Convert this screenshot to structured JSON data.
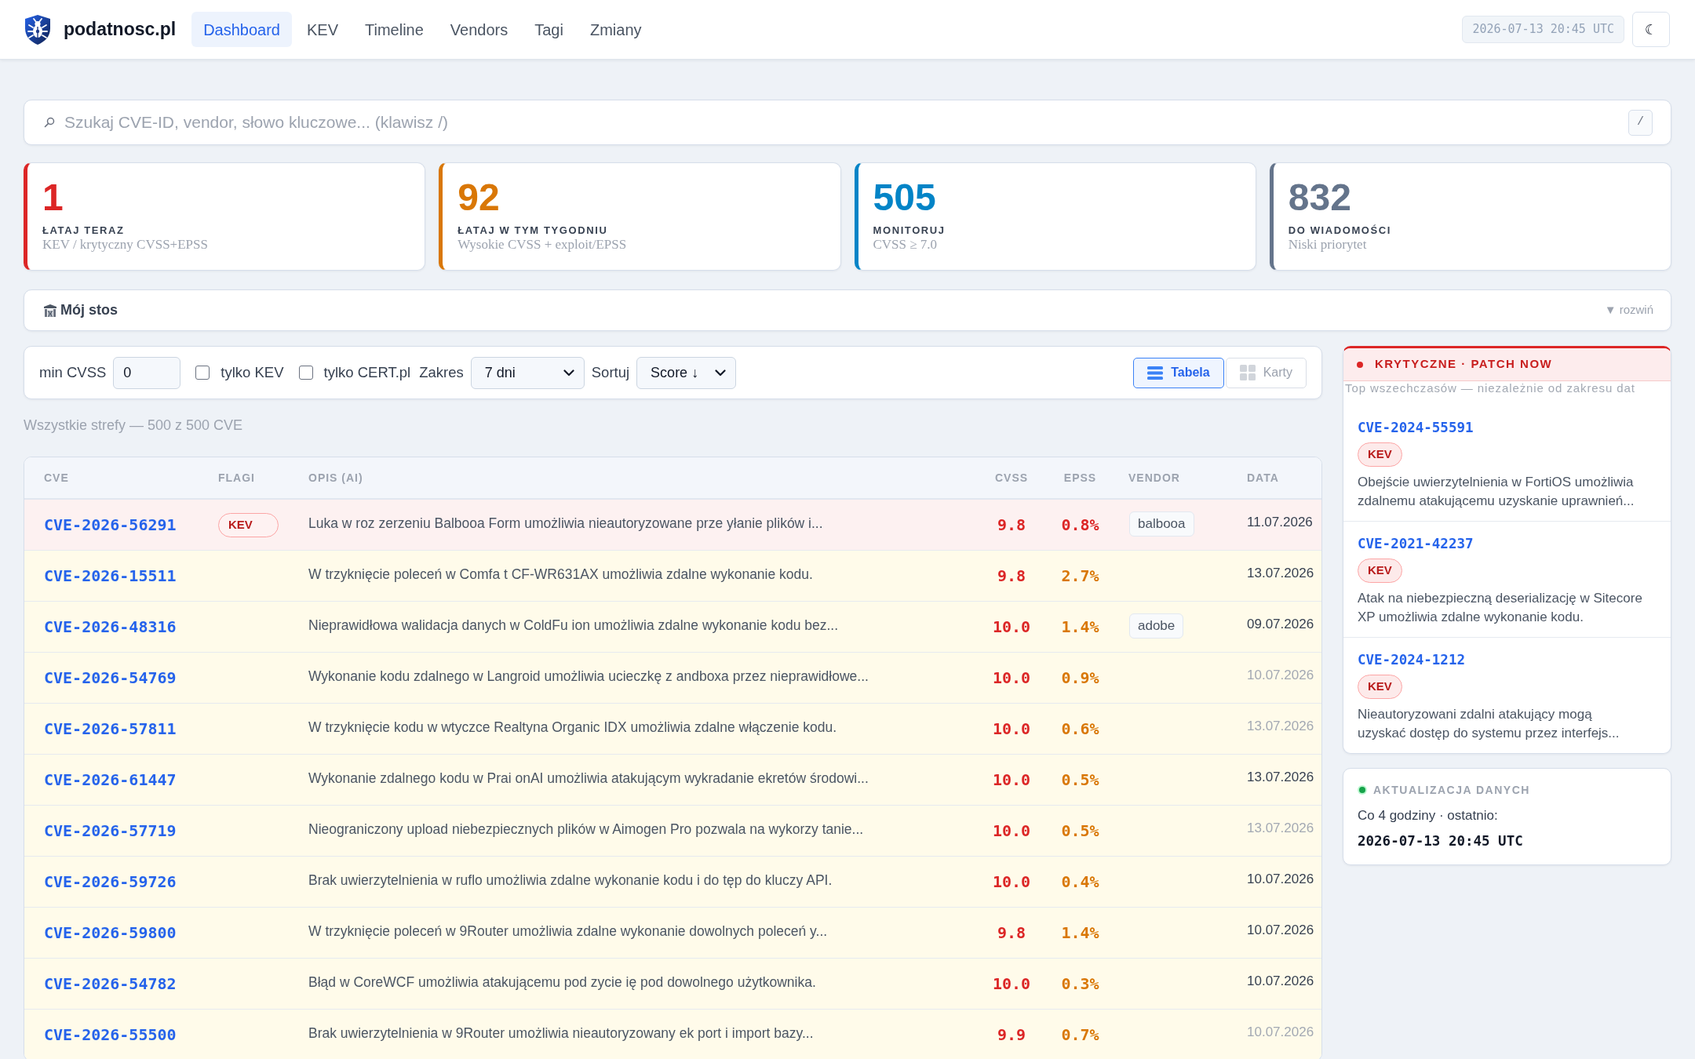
{
  "header": {
    "brand": "podatnosc.pl",
    "nav": [
      {
        "label": "Dashboard",
        "selected": true
      },
      {
        "label": "KEV",
        "selected": false
      },
      {
        "label": "Timeline",
        "selected": false
      },
      {
        "label": "Vendors",
        "selected": false
      },
      {
        "label": "Tagi",
        "selected": false
      },
      {
        "label": "Zmiany",
        "selected": false
      }
    ],
    "timestamp": "2026-07-13 20:45 UTC",
    "theme_toggle": "☾"
  },
  "search": {
    "placeholder": "Szukaj CVE-ID, vendor, słowo kluczowe... (klawisz /)",
    "shortcut": "/"
  },
  "stats": [
    {
      "value": "1",
      "label": "ŁATAJ TERAZ",
      "note": "KEV / krytyczny CVSS+EPSS",
      "color": "#dc2626"
    },
    {
      "value": "92",
      "label": "ŁATAJ W TYM TYGODNIU",
      "note": "Wysokie CVSS + exploit/EPSS",
      "color": "#d97706"
    },
    {
      "value": "505",
      "label": "MONITORUJ",
      "note": "CVSS ≥ 7.0",
      "color": "#0284c7"
    },
    {
      "value": "832",
      "label": "DO WIADOMOŚCI",
      "note": "Niski priorytet",
      "color": "#64748b"
    }
  ],
  "stack": {
    "title": "Mój stos",
    "toggle": "▼ rozwiń"
  },
  "filters": {
    "min_cvss": {
      "label": "min CVSS",
      "value": "0"
    },
    "checkboxes": [
      {
        "label": "tylko KEV",
        "checked": false
      },
      {
        "label": "tylko CERT.pl",
        "checked": false
      }
    ],
    "range": {
      "label": "Zakres",
      "value": "7 dni"
    },
    "sort": {
      "label": "Sortuj",
      "value": "Score ↓"
    },
    "views": [
      {
        "label": "Tabela",
        "kind": "table",
        "selected": true
      },
      {
        "label": "Karty",
        "kind": "cards",
        "selected": false
      }
    ]
  },
  "summary": "Wszystkie strefy — 500 z 500 CVE",
  "table": {
    "columns": [
      "CVE",
      "FLAGI",
      "OPIS (AI)",
      "CVSS",
      "EPSS",
      "VENDOR",
      "DATA"
    ],
    "rows": [
      {
        "kind": "critical",
        "cve": "CVE-2026-56291",
        "flags": [
          "KEV"
        ],
        "description": "Luka w roz zerzeniu Balbooa Form umożliwia nieautoryzowane prze yłanie plików i...",
        "cvss": "9.8",
        "epss": "0.8%",
        "vendor": "balbooa",
        "date": "11.07.2026",
        "date_dimmed": false
      },
      {
        "kind": "high",
        "cve": "CVE-2026-15511",
        "description": "W trzyknięcie poleceń w Comfa t CF-WR631AX umożliwia zdalne wykonanie kodu.",
        "cvss": "9.8",
        "epss": "2.7%",
        "date": "13.07.2026",
        "date_dimmed": false
      },
      {
        "kind": "high",
        "cve": "CVE-2026-48316",
        "description": "Nieprawidłowa walidacja danych w ColdFu ion umożliwia zdalne wykonanie kodu bez...",
        "cvss": "10.0",
        "epss": "1.4%",
        "vendor": "adobe",
        "date": "09.07.2026",
        "date_dimmed": false
      },
      {
        "kind": "high",
        "cve": "CVE-2026-54769",
        "description": "Wykonanie kodu zdalnego w Langroid umożliwia ucieczkę z andboxa przez nieprawidłowe...",
        "cvss": "10.0",
        "epss": "0.9%",
        "date": "10.07.2026",
        "date_dimmed": true
      },
      {
        "kind": "high",
        "cve": "CVE-2026-57811",
        "description": "W trzyknięcie kodu w wtyczce Realtyna Organic IDX umożliwia zdalne włączenie kodu.",
        "cvss": "10.0",
        "epss": "0.6%",
        "date": "13.07.2026",
        "date_dimmed": true
      },
      {
        "kind": "high",
        "cve": "CVE-2026-61447",
        "description": "Wykonanie zdalnego kodu w Prai onAI umożliwia atakującym wykradanie ekretów środowi...",
        "cvss": "10.0",
        "epss": "0.5%",
        "date": "13.07.2026",
        "date_dimmed": false
      },
      {
        "kind": "high",
        "cve": "CVE-2026-57719",
        "description": "Nieograniczony upload niebezpiecznych plików w Aimogen Pro pozwala na wykorzy tanie...",
        "cvss": "10.0",
        "epss": "0.5%",
        "date": "13.07.2026",
        "date_dimmed": true
      },
      {
        "kind": "high",
        "cve": "CVE-2026-59726",
        "description": "Brak uwierzytelnienia w ruflo umożliwia zdalne wykonanie kodu i do tęp do kluczy API.",
        "cvss": "10.0",
        "epss": "0.4%",
        "date": "10.07.2026",
        "date_dimmed": false
      },
      {
        "kind": "high",
        "cve": "CVE-2026-59800",
        "description": "W trzyknięcie poleceń w 9Router umożliwia zdalne wykonanie dowolnych poleceń y...",
        "cvss": "9.8",
        "epss": "1.4%",
        "date": "10.07.2026",
        "date_dimmed": false
      },
      {
        "kind": "high",
        "cve": "CVE-2026-54782",
        "description": "Błąd w CoreWCF umożliwia atakującemu pod zycie ię pod dowolnego użytkownika.",
        "cvss": "10.0",
        "epss": "0.3%",
        "date": "10.07.2026",
        "date_dimmed": false
      },
      {
        "kind": "high",
        "cve": "CVE-2026-55500",
        "description": "Brak uwierzytelnienia w 9Router umożliwia nieautoryzowany ek port i import bazy...",
        "cvss": "9.9",
        "epss": "0.7%",
        "date": "10.07.2026",
        "date_dimmed": true
      }
    ]
  },
  "critical": {
    "title": "KRYTYCZNE · PATCH NOW",
    "subtitle": "Top wszechczasów — niezależnie od zakresu dat",
    "items": [
      {
        "cve": "CVE-2024-55591",
        "flags": [
          "KEV"
        ],
        "description": "Obejście uwierzytelnienia w FortiOS umożliwia zdalnemu atakującemu uzyskanie uprawnień..."
      },
      {
        "cve": "CVE-2021-42237",
        "flags": [
          "KEV"
        ],
        "description": "Atak na niebezpieczną deserializację w Sitecore XP umożliwia zdalne wykonanie kodu."
      },
      {
        "cve": "CVE-2024-1212",
        "flags": [
          "KEV"
        ],
        "description": "Nieautoryzowani zdalni atakujący mogą uzyskać dostęp do systemu przez interfejs..."
      }
    ]
  },
  "update": {
    "title": "AKTUALIZACJA DANYCH",
    "text": "Co 4 godziny · ostatnio:",
    "timestamp": "2026-07-13 20:45 UTC"
  }
}
